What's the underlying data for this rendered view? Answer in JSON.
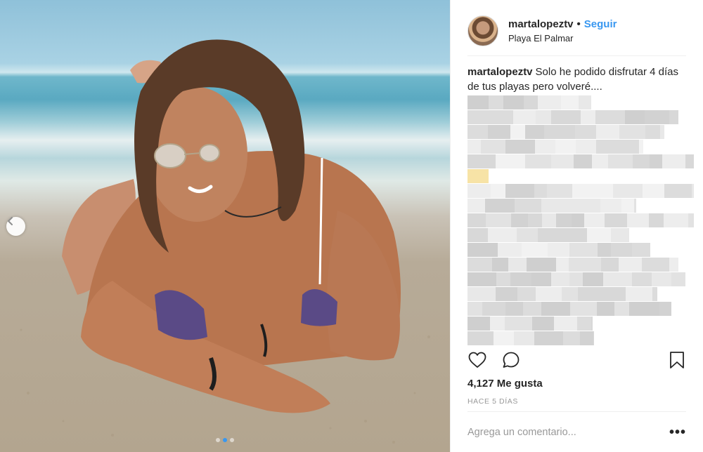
{
  "post": {
    "author": "martalopeztv",
    "separator": "•",
    "follow_label": "Seguir",
    "location": "Playa El Palmar",
    "caption_text": "Solo he podido disfrutar 4 días de tus playas pero volveré....",
    "likes_text": "4,127 Me gusta",
    "time_text": "HACE 5 DÍAS",
    "comment_placeholder": "Agrega un comentario...",
    "more_label": "•••"
  },
  "carousel": {
    "slide_count": 3,
    "active_index": 1
  },
  "icons": {
    "prev": "chevron-left-icon",
    "like": "heart-icon",
    "comment": "comment-icon",
    "save": "bookmark-icon"
  },
  "colors": {
    "accent": "#3897f0",
    "text": "#262626",
    "muted": "#999999",
    "divider": "#efefef"
  }
}
